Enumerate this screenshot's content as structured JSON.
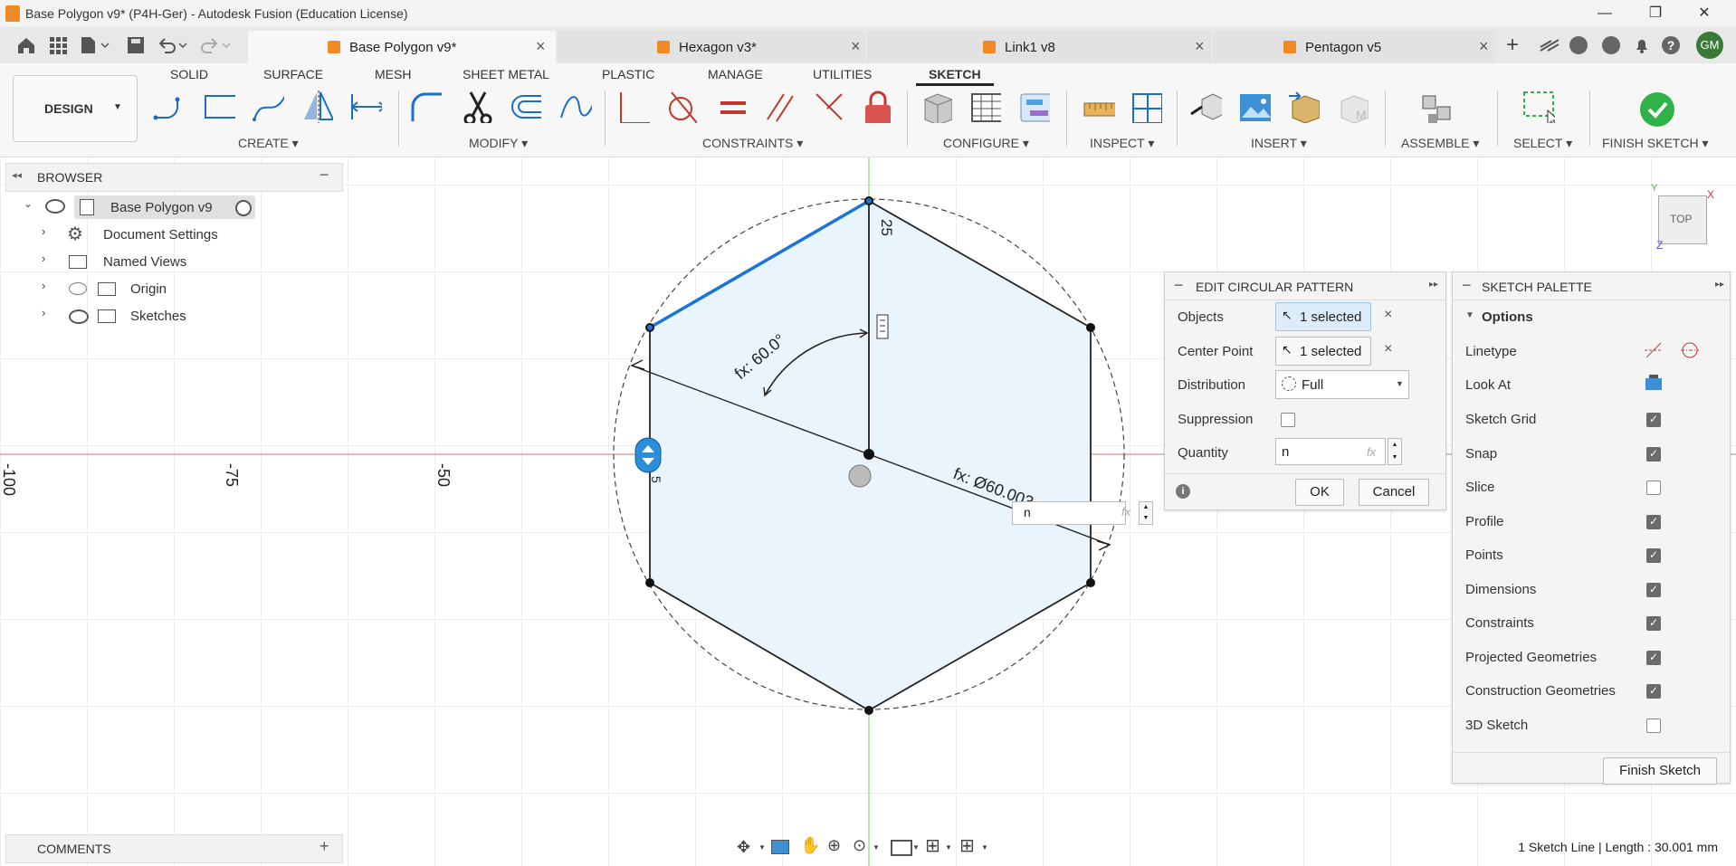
{
  "window": {
    "title": "Base Polygon v9* (P4H-Ger) - Autodesk Fusion (Education License)",
    "minimize": "—",
    "maximize": "❐",
    "close": "✕"
  },
  "tabs": [
    {
      "label": "Base Polygon v9*",
      "active": true
    },
    {
      "label": "Hexagon v3*",
      "active": false
    },
    {
      "label": "Link1 v8",
      "active": false
    },
    {
      "label": "Pentagon v5",
      "active": false
    }
  ],
  "user_initials": "GM",
  "workspace": {
    "label": "DESIGN"
  },
  "ribbon_tabs": [
    "SOLID",
    "SURFACE",
    "MESH",
    "SHEET METAL",
    "PLASTIC",
    "MANAGE",
    "UTILITIES",
    "SKETCH"
  ],
  "ribbon_groups": {
    "create": "CREATE",
    "modify": "MODIFY",
    "constraints": "CONSTRAINTS",
    "configure": "CONFIGURE",
    "inspect": "INSPECT",
    "insert": "INSERT",
    "assemble": "ASSEMBLE",
    "select": "SELECT",
    "finish_sketch": "FINISH SKETCH"
  },
  "browser": {
    "title": "BROWSER",
    "root": "Base Polygon v9",
    "items": [
      "Document Settings",
      "Named Views",
      "Origin",
      "Sketches"
    ]
  },
  "canvas": {
    "axis_labels": [
      "-100",
      "-75",
      "-50"
    ],
    "dim_angle": "fx: 60.0°",
    "dim_vertical": "25",
    "dim_diameter": "fx: Ø60.003",
    "inline_input_value": "n",
    "inline_input_fx": "fx",
    "viewcube": "TOP",
    "axis_x": "X",
    "axis_y": "Y",
    "axis_z": "Z",
    "side_digit": "5"
  },
  "edit_pattern": {
    "title": "EDIT CIRCULAR PATTERN",
    "objects_label": "Objects",
    "objects_value": "1 selected",
    "center_label": "Center Point",
    "center_value": "1 selected",
    "distribution_label": "Distribution",
    "distribution_value": "Full",
    "suppression_label": "Suppression",
    "quantity_label": "Quantity",
    "quantity_value": "n",
    "quantity_fx": "fx",
    "ok": "OK",
    "cancel": "Cancel"
  },
  "sketch_palette": {
    "title": "SKETCH PALETTE",
    "section": "Options",
    "linetype_label": "Linetype",
    "lookat_label": "Look At",
    "options": [
      {
        "label": "Sketch Grid",
        "checked": true
      },
      {
        "label": "Snap",
        "checked": true
      },
      {
        "label": "Slice",
        "checked": false
      },
      {
        "label": "Profile",
        "checked": true
      },
      {
        "label": "Points",
        "checked": true
      },
      {
        "label": "Dimensions",
        "checked": true
      },
      {
        "label": "Constraints",
        "checked": true
      },
      {
        "label": "Projected Geometries",
        "checked": true
      },
      {
        "label": "Construction Geometries",
        "checked": true
      },
      {
        "label": "3D Sketch",
        "checked": false
      }
    ],
    "finish_button": "Finish Sketch"
  },
  "comments": {
    "title": "COMMENTS",
    "add": "+"
  },
  "status": "1 Sketch Line | Length : 30.001 mm",
  "colors": {
    "accent_blue": "#1a73d9",
    "finish_green": "#2fb24a",
    "profile_fill": "#eaf4fc",
    "tab_orange": "#f08a24"
  }
}
